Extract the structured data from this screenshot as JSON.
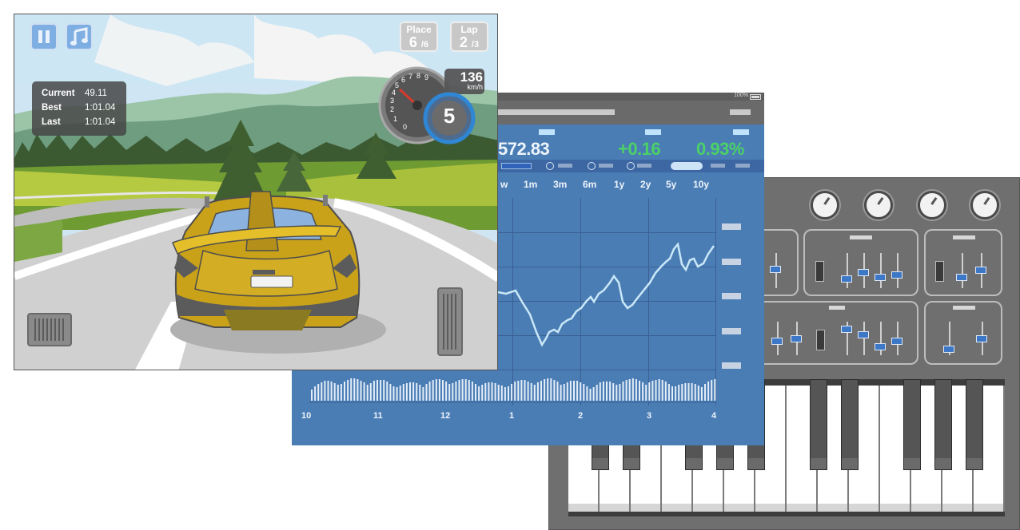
{
  "game": {
    "place": {
      "label": "Place",
      "value": "6",
      "total": "/6"
    },
    "lap": {
      "label": "Lap",
      "value": "2",
      "total": "/3"
    },
    "times": [
      {
        "label": "Current",
        "value": "49.11"
      },
      {
        "label": "Best",
        "value": "1:01.04"
      },
      {
        "label": "Last",
        "value": "1:01.04"
      }
    ],
    "speed": {
      "value": "136",
      "unit": "km/h"
    },
    "gear": "5",
    "tach_numbers": [
      "0",
      "1",
      "2",
      "3",
      "4",
      "5",
      "6",
      "7",
      "8",
      "9"
    ],
    "icons": {
      "pause": "pause-icon",
      "music": "music-note-icon"
    }
  },
  "stock": {
    "battery": "100%",
    "price": "572.83",
    "change": "+0.16",
    "percent": "0.93%",
    "change_color": "#4bd166",
    "ranges": [
      "w",
      "1m",
      "3m",
      "6m",
      "1y",
      "2y",
      "5y",
      "10y"
    ],
    "x_labels": [
      "10",
      "11",
      "12",
      "1",
      "2",
      "3",
      "4"
    ]
  },
  "synth": {
    "knob_count": 4,
    "white_key_count": 14
  }
}
